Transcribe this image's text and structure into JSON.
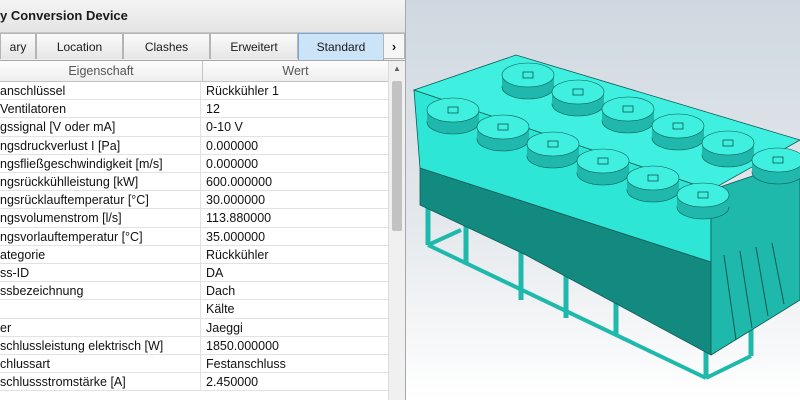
{
  "window": {
    "title": "y Conversion Device"
  },
  "tabs": [
    {
      "label": "ary"
    },
    {
      "label": "Location"
    },
    {
      "label": "Clashes"
    },
    {
      "label": "Erweitert"
    },
    {
      "label": "Standard",
      "active": true
    }
  ],
  "tab_scroll": {
    "label": "›"
  },
  "table": {
    "headers": {
      "property": "Eigenschaft",
      "value": "Wert"
    },
    "rows": [
      {
        "property": "anschlüssel",
        "value": "Rückkühler 1"
      },
      {
        "property": "Ventilatoren",
        "value": "12"
      },
      {
        "property": "gssignal [V oder mA]",
        "value": "0-10 V"
      },
      {
        "property": "ngsdruckverlust I [Pa]",
        "value": "0.000000"
      },
      {
        "property": "ngsfließgeschwindigkeit [m/s]",
        "value": "0.000000"
      },
      {
        "property": "ngsrückkühlleistung [kW]",
        "value": "600.000000"
      },
      {
        "property": "ngsrücklauftemperatur [°C]",
        "value": "30.000000"
      },
      {
        "property": "ngsvolumenstrom [l/s]",
        "value": "113.880000"
      },
      {
        "property": "ngsvorlauftemperatur [°C]",
        "value": "35.000000"
      },
      {
        "property": "ategorie",
        "value": "Rückkühler"
      },
      {
        "property": "ss-ID",
        "value": "DA"
      },
      {
        "property": "ssbezeichnung",
        "value": "Dach"
      },
      {
        "property": "",
        "value": "Kälte"
      },
      {
        "property": "er",
        "value": "Jaeggi"
      },
      {
        "property": "schlussleistung elektrisch [W]",
        "value": "1850.000000"
      },
      {
        "property": "chlussart",
        "value": "Festanschluss"
      },
      {
        "property": "schlussstromstärke [A]",
        "value": "2.450000"
      }
    ]
  },
  "viewport": {
    "model": "dry-cooler-unit",
    "fan_count": 12,
    "colors": {
      "body": "#2ee6d6",
      "body_side": "#1fb9ac",
      "body_shadow": "#138a80",
      "fan_top": "#3ff0e0",
      "fan_side": "#20b8ac",
      "edge": "#0d5a54"
    }
  }
}
